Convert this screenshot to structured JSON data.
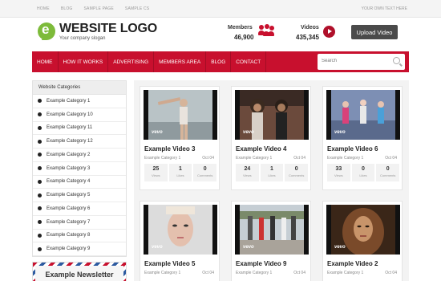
{
  "topbar": {
    "links": [
      "HOME",
      "BLOG",
      "SAMPLE PAGE",
      "SAMPLE CS"
    ],
    "right_text": "YOUR OWN TEXT HERE"
  },
  "header": {
    "logo_letter": "e",
    "logo_text": "WEBSITE LOGO",
    "slogan": "Your company slogan",
    "members_label": "Members",
    "members_value": "46,900",
    "videos_label": "Videos",
    "videos_value": "435,345",
    "upload_label": "Upload Video"
  },
  "nav": {
    "items": [
      "HOME",
      "HOW IT WORKS",
      "ADVERTISING",
      "MEMBERS AREA",
      "BLOG",
      "CONTACT"
    ],
    "search_placeholder": "Search"
  },
  "sidebar": {
    "title": "Website Categories",
    "categories": [
      "Example Category 1",
      "Example Category 10",
      "Example Category 11",
      "Example Category 12",
      "Example Category 2",
      "Example Category 3",
      "Example Category 4",
      "Example Category 5",
      "Example Category 6",
      "Example Category 7",
      "Example Category 8",
      "Example Category 9"
    ],
    "newsletter_title": "Example Newsletter"
  },
  "videos": [
    {
      "title": "Example Video 3",
      "category": "Example Category 1",
      "date": "Oct 04",
      "views": "25",
      "likes": "1",
      "comments": "0"
    },
    {
      "title": "Example Video 4",
      "category": "Example Category 1",
      "date": "Oct 04",
      "views": "24",
      "likes": "1",
      "comments": "0"
    },
    {
      "title": "Example Video 6",
      "category": "Example Category 1",
      "date": "Oct 04",
      "views": "33",
      "likes": "0",
      "comments": "0"
    },
    {
      "title": "Example Video 5",
      "category": "Example Category 1",
      "date": "Oct 04",
      "views": "",
      "likes": "",
      "comments": ""
    },
    {
      "title": "Example Video 9",
      "category": "Example Category 1",
      "date": "Oct 04",
      "views": "",
      "likes": "",
      "comments": ""
    },
    {
      "title": "Example Video 2",
      "category": "Example Category 1",
      "date": "Oct 04",
      "views": "",
      "likes": "",
      "comments": ""
    }
  ],
  "labels": {
    "views": "Views",
    "likes": "Likes",
    "comments": "Comments",
    "thumb_logo": "vevo"
  },
  "colors": {
    "accent_red": "#c8102e",
    "logo_green": "#7dbb3a",
    "upload_button": "#4a4a4a"
  }
}
